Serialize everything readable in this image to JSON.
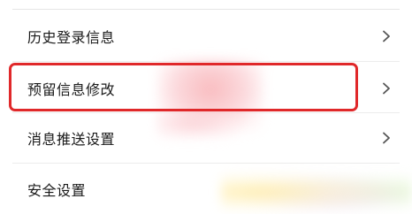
{
  "settings": {
    "items": [
      {
        "label": "历史登录信息",
        "chevron_icon": "chevron-right-icon"
      },
      {
        "label": "预留信息修改",
        "chevron_icon": "chevron-right-icon"
      },
      {
        "label": "消息推送设置",
        "chevron_icon": "chevron-right-icon"
      },
      {
        "label": "安全设置"
      }
    ]
  },
  "highlight": {
    "color": "#e0282a",
    "target_item": "预留信息修改"
  },
  "colors": {
    "background": "#ffffff",
    "text": "#1a1a1a",
    "divider": "#ececec",
    "chevron": "#555555"
  }
}
